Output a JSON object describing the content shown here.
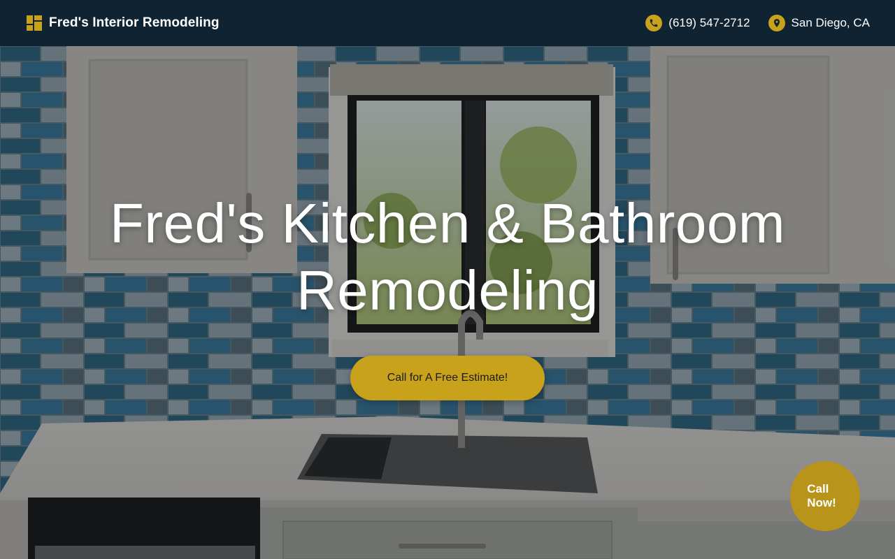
{
  "header": {
    "brand_name": "Fred's Interior Remodeling",
    "phone": "(619) 547-2712",
    "location": "San Diego, CA",
    "logo_icon": "grid-logo-icon",
    "phone_icon": "phone-icon",
    "location_icon": "map-pin-icon"
  },
  "hero": {
    "title_line1": "Fred's Kitchen & Bathroom",
    "title_line2": "Remodeling",
    "cta_label": "Call for A Free Estimate!",
    "background": "kitchen-photo"
  },
  "floating": {
    "call_now_line1": "Call",
    "call_now_line2": "Now!"
  },
  "colors": {
    "header_bg": "#0f2333",
    "accent": "#c9a21c",
    "text_light": "#ffffff"
  }
}
